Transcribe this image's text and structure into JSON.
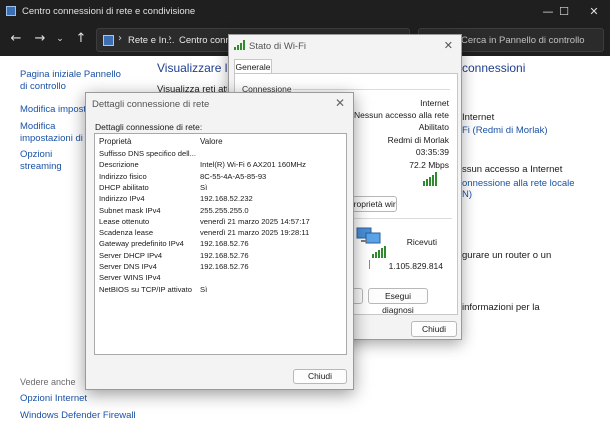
{
  "window": {
    "title": "Centro connessioni di rete e condivisione",
    "controls": [
      "—",
      "☐",
      "✕"
    ]
  },
  "navbar": {
    "breadcrumb": [
      "Rete e In...",
      "Centro connes"
    ],
    "search_placeholder": "Cerca in Pannello di controllo"
  },
  "left_pane": {
    "links": [
      "Pagina iniziale Pannello di controllo",
      "Modifica impostazioni scheda",
      "Modifica impostazioni di condivisione avanzate",
      "Opzioni streaming multimediale"
    ],
    "see_also_title": "Vedere anche",
    "see_also": [
      "Opzioni Internet",
      "Windows Defender Firewall"
    ]
  },
  "content": {
    "heading_left": "Visualizzare le",
    "heading_right": "connessioni",
    "sub_left": "Visualizza reti attive",
    "fragments": [
      "Internet",
      "Fi (Redmi di Morlak)",
      "ssun accesso a Internet",
      "onnessione alla rete locale",
      "N)",
      "gurare un router o un",
      "informazioni per la"
    ]
  },
  "wifi_dialog": {
    "title": "Stato di Wi-Fi",
    "tab": "Generale",
    "group_connection": "Connessione",
    "values": [
      "Internet",
      "Nessun accesso alla rete",
      "Abilitato",
      "Redmi di Morlak",
      "03:35:39",
      "72.2 Mbps"
    ],
    "wireless_button": "Proprietà wireless",
    "activity_received_label": "Ricevuti",
    "activity_received": "1.105.829.814",
    "diagnose_button": "Esegui diagnosi",
    "close_button": "Chiudi"
  },
  "details_dialog": {
    "title": "Dettagli connessione di rete",
    "list_label": "Dettagli connessione di rete:",
    "col_property": "Proprietà",
    "col_value": "Valore",
    "rows": [
      {
        "p": "Suffisso DNS specifico dell...",
        "v": ""
      },
      {
        "p": "Descrizione",
        "v": "Intel(R) Wi-Fi 6 AX201 160MHz"
      },
      {
        "p": "Indirizzo fisico",
        "v": "8C-55-4A-A5-85-93"
      },
      {
        "p": "DHCP abilitato",
        "v": "Sì"
      },
      {
        "p": "Indirizzo IPv4",
        "v": "192.168.52.232"
      },
      {
        "p": "Subnet mask IPv4",
        "v": "255.255.255.0"
      },
      {
        "p": "Lease ottenuto",
        "v": "venerdì 21 marzo 2025 14:57:17"
      },
      {
        "p": "Scadenza lease",
        "v": "venerdì 21 marzo 2025 19:28:11"
      },
      {
        "p": "Gateway predefinito IPv4",
        "v": "192.168.52.76"
      },
      {
        "p": "Server DHCP IPv4",
        "v": "192.168.52.76"
      },
      {
        "p": "Server DNS IPv4",
        "v": "192.168.52.76"
      },
      {
        "p": "Server WINS IPv4",
        "v": ""
      },
      {
        "p": "NetBIOS su TCP/IP attivato",
        "v": "Sì"
      }
    ],
    "close_button": "Chiudi"
  },
  "colors": {
    "link": "#1a52a5",
    "heading": "#1f3e8c",
    "signal": "#2e8b2e",
    "titlebar": "#1f1f1f"
  }
}
